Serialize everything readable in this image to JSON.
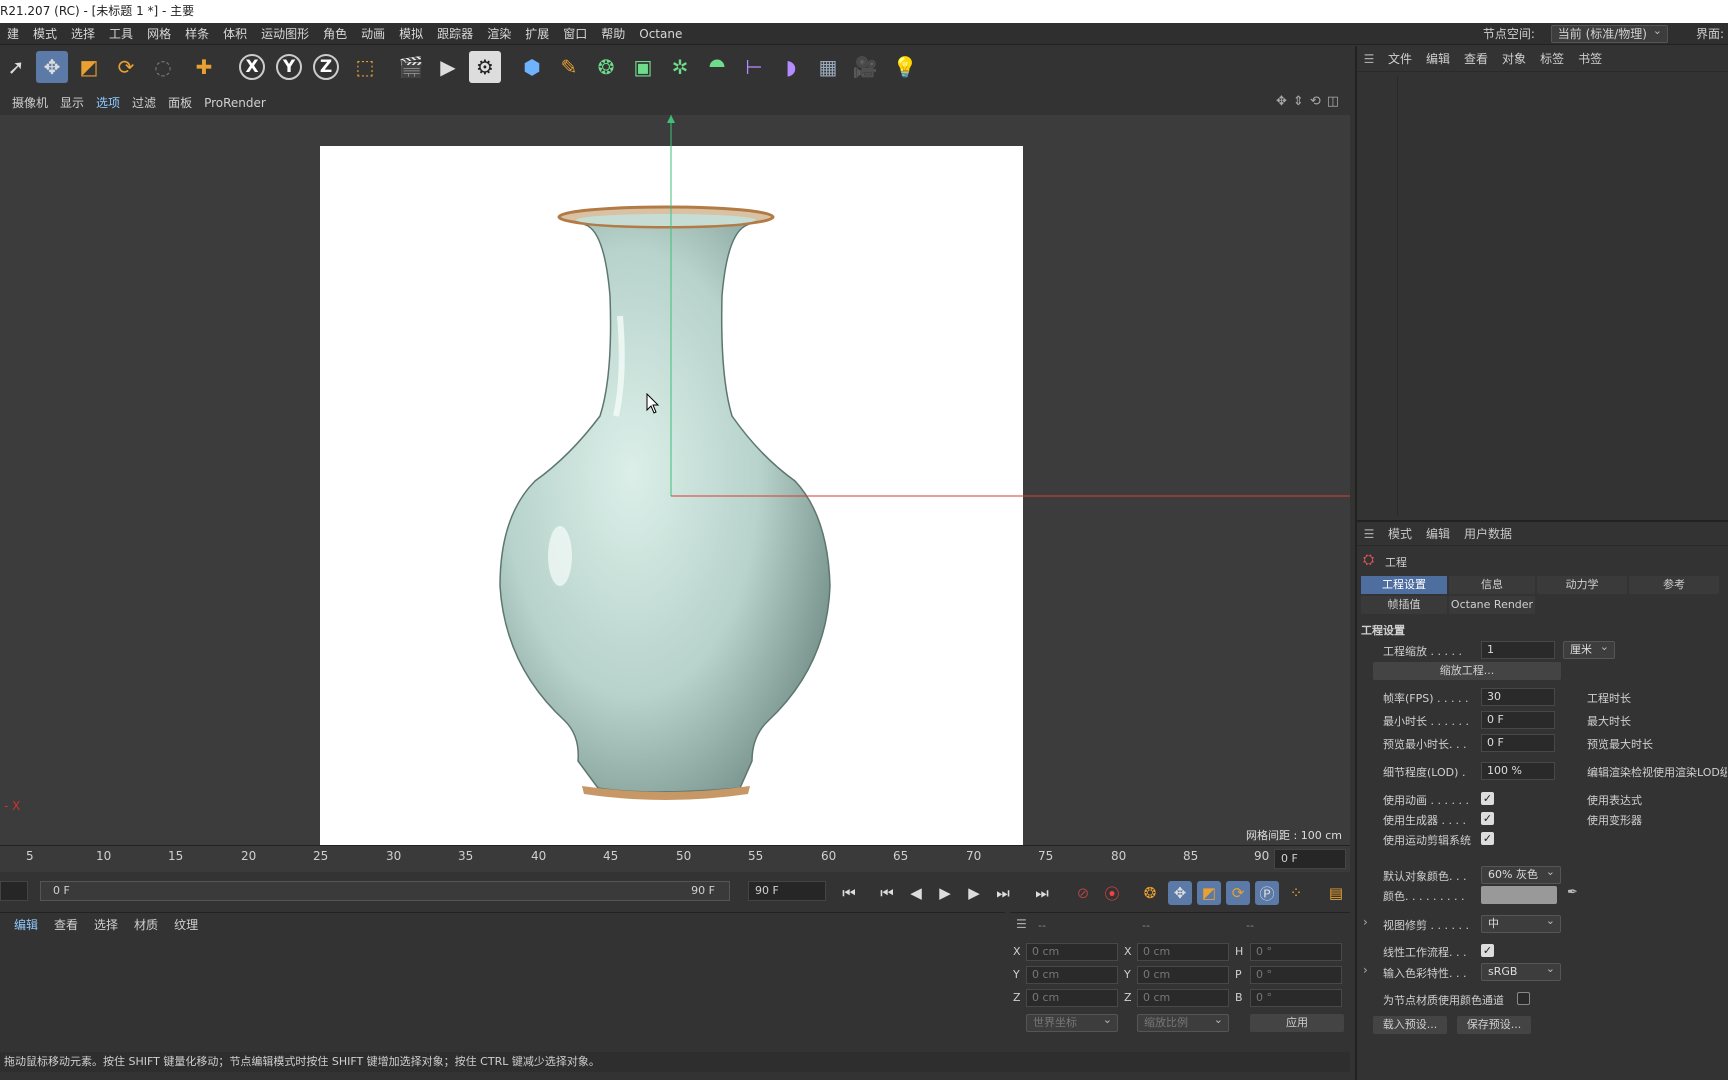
{
  "window": {
    "title": "R21.207 (RC) - [未标题 1 *] - 主要"
  },
  "menu": {
    "items": [
      "建",
      "模式",
      "选择",
      "工具",
      "网格",
      "样条",
      "体积",
      "运动图形",
      "角色",
      "动画",
      "模拟",
      "跟踪器",
      "渲染",
      "扩展",
      "窗口",
      "帮助",
      "Octane"
    ]
  },
  "node_space": {
    "label": "节点空间:",
    "value": "当前 (标准/物理)",
    "interface_label": "界面:"
  },
  "viewport_menu": {
    "items": [
      "摄像机",
      "显示",
      "选项",
      "过滤",
      "面板",
      "ProRender"
    ],
    "selected": "选项"
  },
  "viewport": {
    "grid_info": "网格间距 : 100 cm"
  },
  "timeline": {
    "ticks": [
      "5",
      "10",
      "15",
      "20",
      "25",
      "30",
      "35",
      "40",
      "45",
      "50",
      "55",
      "60",
      "65",
      "70",
      "75",
      "80",
      "85",
      "90"
    ],
    "current_frame": "0 F",
    "start_field": "0 F",
    "range_start": "0 F",
    "range_end": "90 F",
    "end_field": "90 F"
  },
  "material_menu": {
    "items": [
      "编辑",
      "查看",
      "选择",
      "材质",
      "纹理"
    ],
    "selected": "编辑"
  },
  "coords": {
    "rows": [
      {
        "a": "X",
        "av": "0 cm",
        "b": "X",
        "bv": "0 cm",
        "c": "H",
        "cv": "0 °"
      },
      {
        "a": "Y",
        "av": "0 cm",
        "b": "Y",
        "bv": "0 cm",
        "c": "P",
        "cv": "0 °"
      },
      {
        "a": "Z",
        "av": "0 cm",
        "b": "Z",
        "bv": "0 cm",
        "c": "B",
        "cv": "0 °"
      }
    ],
    "headers": [
      "--",
      "--",
      "--"
    ],
    "world": "世界坐标",
    "scale": "缩放比例",
    "apply": "应用"
  },
  "status": "拖动鼠标移动元素。按住 SHIFT 键量化移动；节点编辑模式时按住 SHIFT 键增加选择对象；按住 CTRL 键减少选择对象。",
  "object_menu": {
    "items": [
      "文件",
      "编辑",
      "查看",
      "对象",
      "标签",
      "书签"
    ]
  },
  "attr_menu": {
    "items": [
      "模式",
      "编辑",
      "用户数据"
    ]
  },
  "attr": {
    "object_name": "工程",
    "tabs_row1": [
      "工程设置",
      "信息",
      "动力学",
      "参考"
    ],
    "tabs_row2": [
      "帧插值",
      "Octane Render"
    ],
    "section": "工程设置",
    "scale_label": "工程缩放 . . . . .",
    "scale_value": "1",
    "scale_unit": "厘米",
    "scale_btn": "缩放工程...",
    "fps_label": "帧率(FPS) . . . . .",
    "fps_value": "30",
    "duration_label": "工程时长",
    "min_label": "最小时长 . . . . . .",
    "min_value": "0 F",
    "max_label": "最大时长",
    "pmin_label": "预览最小时长. . .",
    "pmin_value": "0 F",
    "pmax_label": "预览最大时长",
    "lod_label": "细节程度(LOD) .",
    "lod_value": "100 %",
    "lod_right": "编辑渲染检视使用渲染LOD级别",
    "use_anim": "使用动画 . . . . . .",
    "use_expr": "使用表达式",
    "use_gen": "使用生成器 . . . .",
    "use_deform": "使用变形器",
    "use_motion": "使用运动剪辑系统",
    "default_color_label": "默认对象颜色. . .",
    "default_color_value": "60% 灰色",
    "color_label": "颜色. . . . . . . . .",
    "clip_label": "视图修剪 . . . . . .",
    "clip_value": "中",
    "linear_label": "线性工作流程. . .",
    "input_color_label": "输入色彩特性. . .",
    "input_color_value": "sRGB",
    "node_color_label": "为节点材质使用颜色通道",
    "load_preset": "载入预设...",
    "save_preset": "保存预设..."
  }
}
